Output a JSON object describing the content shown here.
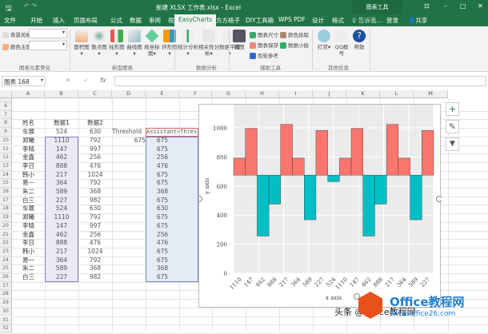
{
  "window": {
    "title": "新建 XLSX 工作表.xlsx - Excel",
    "context_tab": "图表工具",
    "min": "–",
    "max": "□",
    "close": "✕",
    "restore": "⊡"
  },
  "tabs": [
    "文件",
    "开始",
    "插入",
    "页面布局",
    "公式",
    "数据",
    "审阅",
    "视图",
    "EasyCharts",
    "方方格子",
    "DIY工具箱",
    "WPS PDF",
    "设计",
    "格式"
  ],
  "tell_me": "♀ 告诉我...",
  "login": "登录",
  "share": "共享",
  "ribbon": {
    "style": {
      "bg_style": "背景风格",
      "color_theme": "颜色主题",
      "group": "图表元素美化"
    },
    "new_charts": {
      "items": [
        "面积图▾",
        "散点图▾",
        "柱形图▾",
        "曲线图▾",
        "极坐标图▾",
        "环形图▾"
      ],
      "group": "新型图表"
    },
    "analysis": {
      "items": [
        "统计分析▾",
        "相关性分析▾",
        "数据平滑▾"
      ],
      "group": "数据分析"
    },
    "tools": {
      "screenshot": "截图",
      "size": "图表尺寸",
      "save": "图表保存",
      "color_wheel": "色轮参考",
      "picker": "颜色拾取",
      "thief": "数据小偷",
      "group": "辅助工具"
    },
    "other": {
      "items": [
        "打赏▾",
        "QQ群号",
        "帮助"
      ],
      "group": "其他信息"
    }
  },
  "formula_bar": {
    "name_box": "图表 168",
    "cancel": "✕",
    "confirm": "✓",
    "fx": "fx",
    "value": ""
  },
  "columns": [
    "A",
    "B",
    "C",
    "D",
    "E",
    "F",
    "G",
    "H",
    "I",
    "J",
    "K",
    "L",
    "M"
  ],
  "rows": [
    6,
    7,
    8,
    9,
    10,
    11,
    12,
    13,
    14,
    15,
    16,
    17,
    18,
    19,
    20,
    21,
    22,
    23,
    24,
    25,
    26,
    27,
    28,
    29,
    30,
    31,
    32
  ],
  "sheet": {
    "headers": [
      "姓名",
      "数据1",
      "数据2"
    ],
    "names": [
      "车展",
      "郑曦",
      "李晴",
      "金鑫",
      "李日",
      "韩小",
      "易一",
      "朱二",
      "白三",
      "车展",
      "郑曦",
      "李晴",
      "金鑫",
      "李日",
      "韩小",
      "易一",
      "朱二",
      "白三"
    ],
    "data1": [
      524,
      1110,
      147,
      462,
      888,
      217,
      364,
      589,
      227,
      524,
      1110,
      147,
      462,
      888,
      217,
      364,
      589,
      227
    ],
    "data2": [
      630,
      792,
      997,
      256,
      476,
      1024,
      792,
      368,
      982,
      630,
      792,
      997,
      256,
      476,
      1024,
      792,
      368,
      982
    ],
    "threshold_label": "Threshold",
    "threshold": 675,
    "assistant_label": "Assistant>Threshold",
    "assistant": [
      675,
      675,
      256,
      476,
      675,
      675,
      368,
      675,
      630,
      675,
      675,
      256,
      476,
      675,
      675,
      368,
      675
    ]
  },
  "chart_data": {
    "type": "bar",
    "title": "",
    "xlabel": "x axis",
    "ylabel": "y axis",
    "ylim": [
      0,
      1150
    ],
    "baseline": 675,
    "yticks": [
      0,
      200,
      400,
      600,
      800,
      1000
    ],
    "categories": [
      "1110",
      "147",
      "462",
      "888",
      "217",
      "364",
      "589",
      "227",
      "524",
      "1110",
      "147",
      "462",
      "888",
      "217",
      "364",
      "589",
      "227"
    ],
    "values": [
      792,
      997,
      256,
      476,
      1024,
      792,
      368,
      982,
      630,
      792,
      997,
      256,
      476,
      1024,
      792,
      368,
      982
    ],
    "colors": {
      "above": "#f8766d",
      "below": "#00bfc4",
      "panel": "#ebebeb"
    }
  },
  "chart_buttons": {
    "add": "+",
    "style": "✎",
    "filter": "▼"
  },
  "watermark": {
    "source": "头条 @Office教程网",
    "brand": "Office教程网",
    "url": "www.office26.com"
  }
}
